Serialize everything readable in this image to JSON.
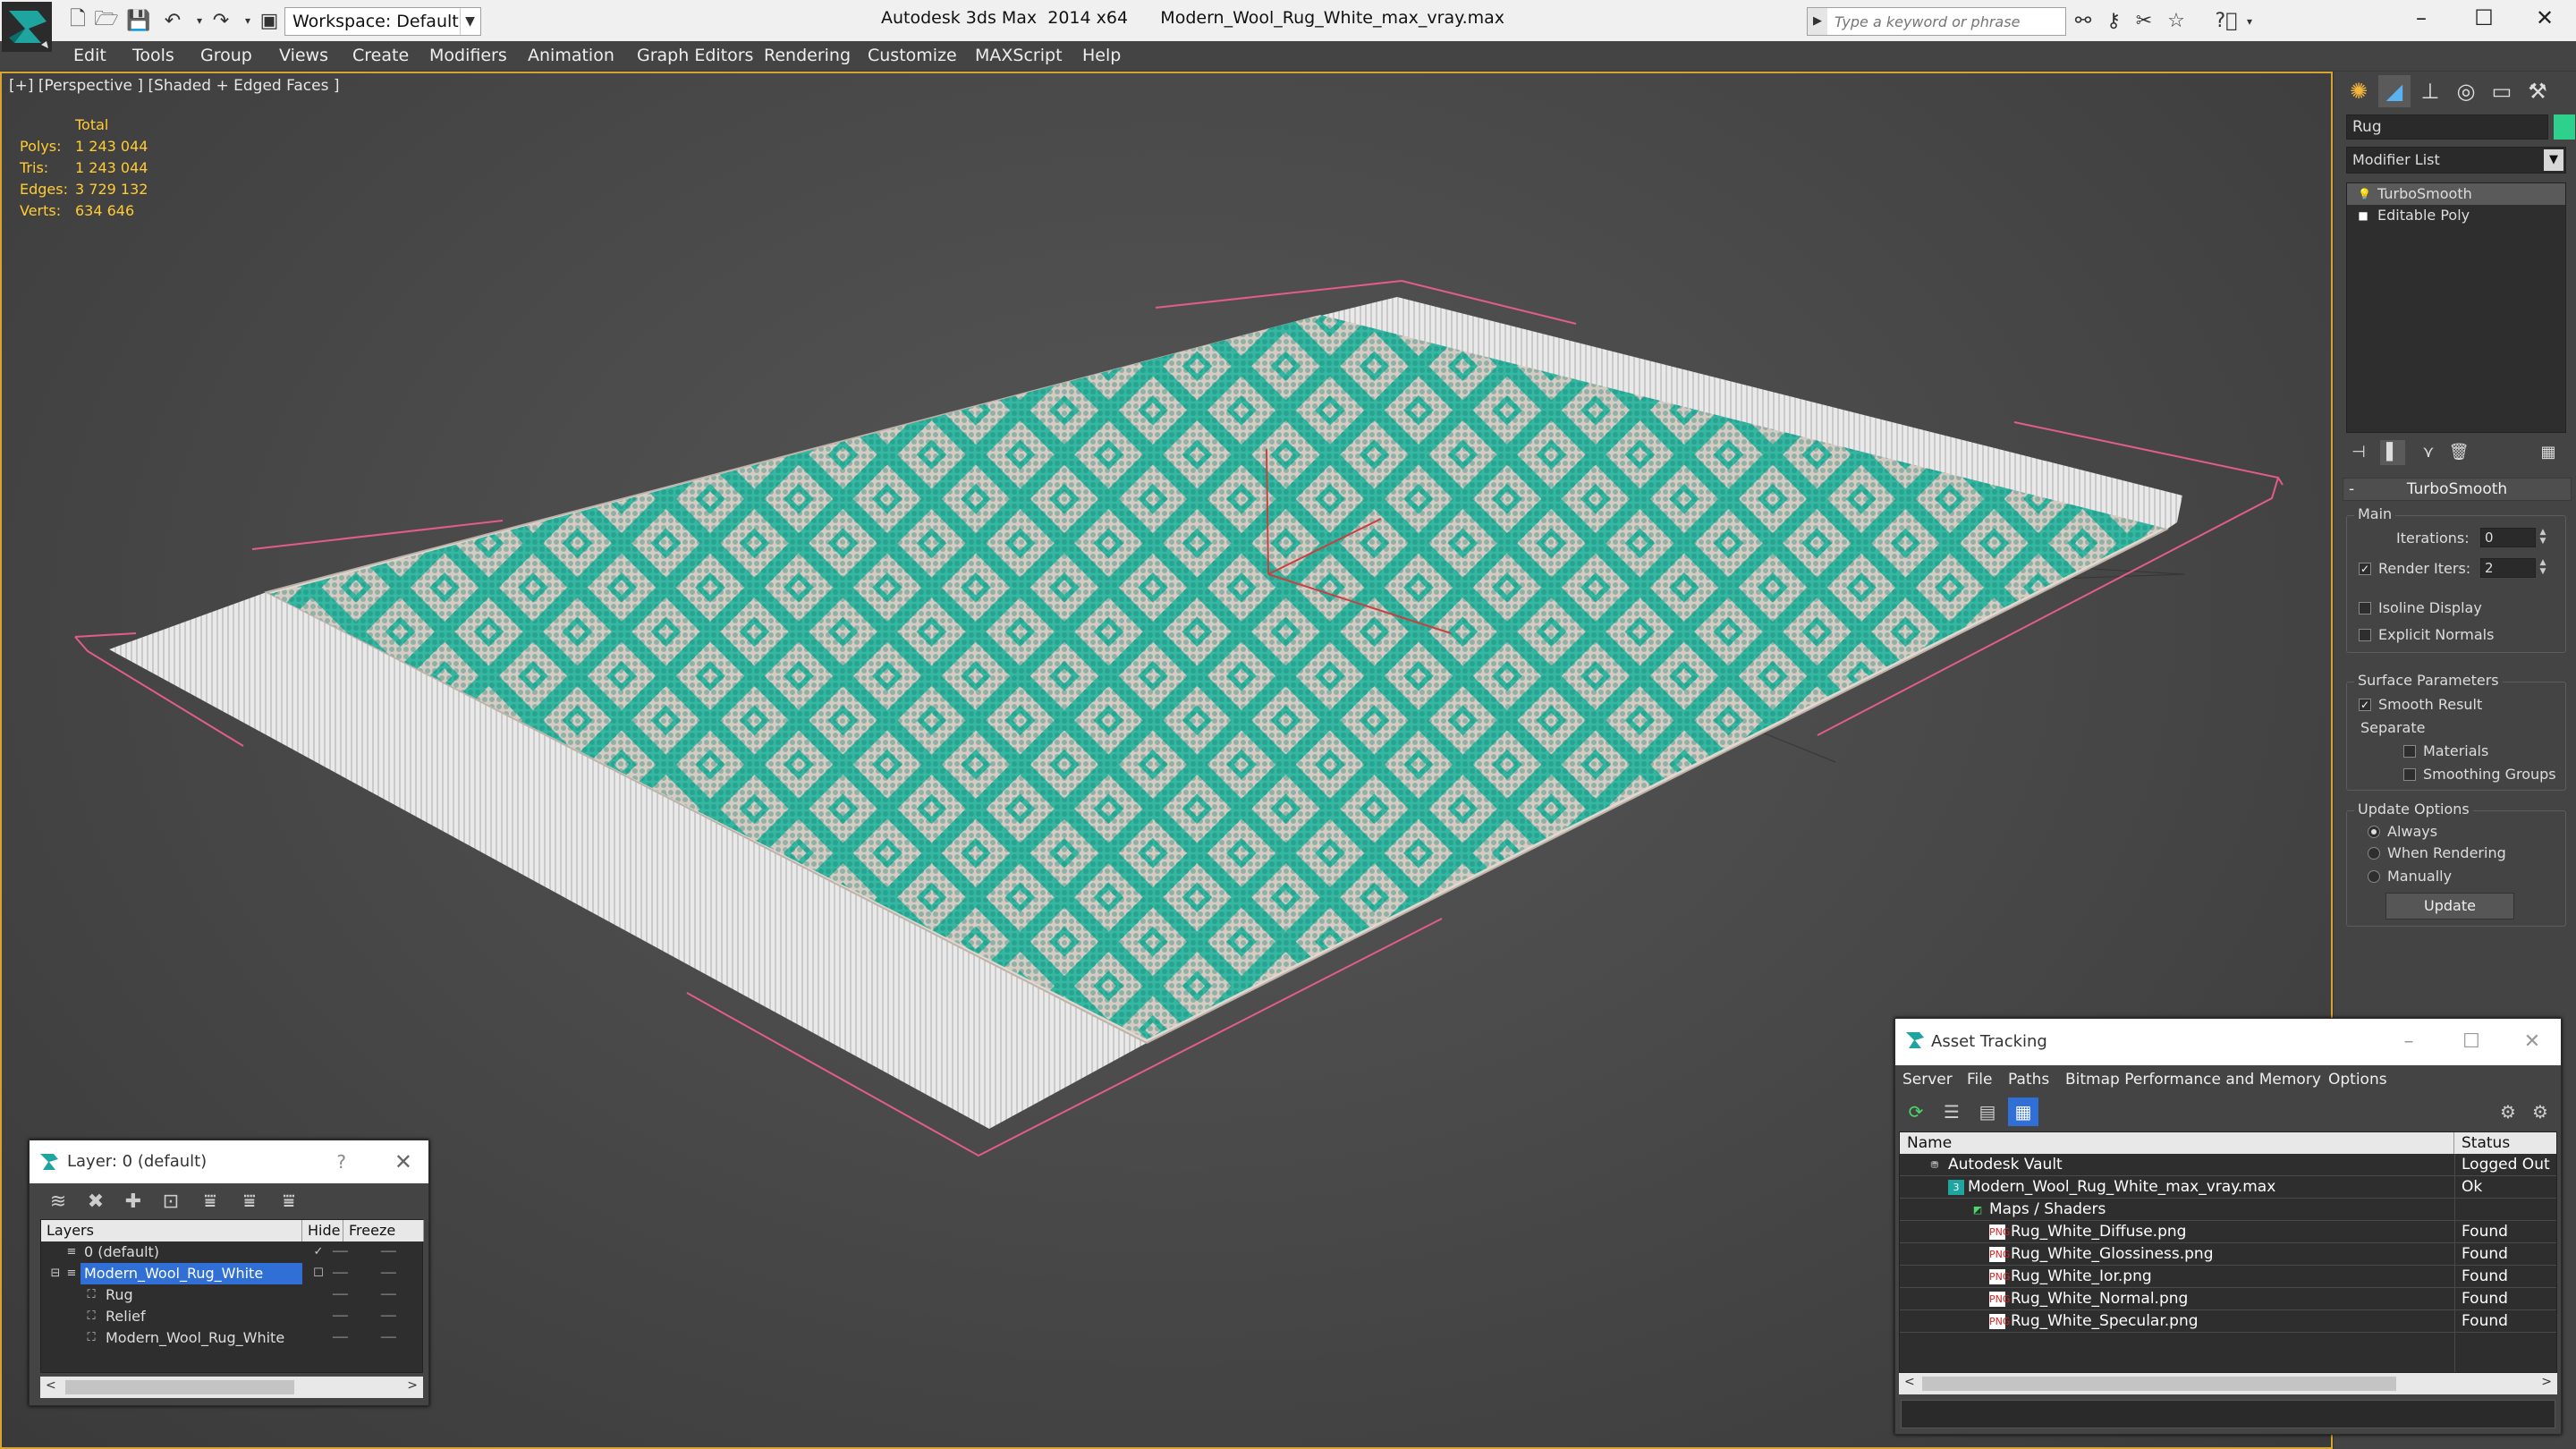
{
  "titlebar": {
    "workspace_label": "Workspace: Default",
    "window_title": "Autodesk 3ds Max  2014 x64      Modern_Wool_Rug_White_max_vray.max",
    "search_placeholder": "Type a keyword or phrase",
    "minimize": "–",
    "maximize": "☐",
    "close": "✕"
  },
  "menu": [
    "Edit",
    "Tools",
    "Group",
    "Views",
    "Create",
    "Modifiers",
    "Animation",
    "Graph Editors",
    "Rendering",
    "Customize",
    "MAXScript",
    "Help"
  ],
  "viewport": {
    "label": "[+] [Perspective ] [Shaded + Edged Faces ]",
    "stats_header": "Total",
    "stats": [
      {
        "label": "Polys:",
        "value": "1 243 044"
      },
      {
        "label": "Tris:",
        "value": "1 243 044"
      },
      {
        "label": "Edges:",
        "value": "3 729 132"
      },
      {
        "label": "Verts:",
        "value": "634 646"
      }
    ]
  },
  "command_panel": {
    "object_name": "Rug",
    "object_color": "#2ed08d",
    "modifier_list": "Modifier List",
    "stack": [
      {
        "label": "TurboSmooth",
        "active": true
      },
      {
        "label": "Editable Poly",
        "active": false
      }
    ],
    "rollout_title": "TurboSmooth",
    "rollout_toggle": "-",
    "main_group": "Main",
    "iterations_label": "Iterations:",
    "iterations_value": "0",
    "render_iters_label": "Render Iters:",
    "render_iters_value": "2",
    "render_iters_checked": true,
    "isoline_label": "Isoline Display",
    "explicit_normals_label": "Explicit Normals",
    "surface_group": "Surface Parameters",
    "smooth_result_label": "Smooth Result",
    "separate_label": "Separate",
    "materials_label": "Materials",
    "smoothing_groups_label": "Smoothing Groups",
    "update_group": "Update Options",
    "always_label": "Always",
    "when_rendering_label": "When Rendering",
    "manually_label": "Manually",
    "update_button": "Update"
  },
  "layer_dialog": {
    "title": "Layer: 0 (default)",
    "help": "?",
    "close": "✕",
    "col_layers": "Layers",
    "col_hide": "Hide",
    "col_freeze": "Freeze",
    "rows": [
      {
        "name": "0 (default)",
        "indent": 0,
        "selected": false,
        "mark": "✓"
      },
      {
        "name": "Modern_Wool_Rug_White",
        "indent": 0,
        "selected": true,
        "mark": "☐"
      },
      {
        "name": "Rug",
        "indent": 1,
        "selected": false,
        "mark": ""
      },
      {
        "name": "Relief",
        "indent": 1,
        "selected": false,
        "mark": ""
      },
      {
        "name": "Modern_Wool_Rug_White",
        "indent": 1,
        "selected": false,
        "mark": ""
      }
    ]
  },
  "asset_tracking": {
    "title": "Asset Tracking",
    "menu": [
      "Server",
      "File",
      "Paths",
      "Bitmap Performance and Memory",
      "Options"
    ],
    "col_name": "Name",
    "col_status": "Status",
    "rows": [
      {
        "name": "Autodesk Vault",
        "status": "Logged Out",
        "indent": 0,
        "icon": "vault"
      },
      {
        "name": "Modern_Wool_Rug_White_max_vray.max",
        "status": "Ok",
        "indent": 1,
        "icon": "max"
      },
      {
        "name": "Maps / Shaders",
        "status": "",
        "indent": 2,
        "icon": "maps"
      },
      {
        "name": "Rug_White_Diffuse.png",
        "status": "Found",
        "indent": 3,
        "icon": "png"
      },
      {
        "name": "Rug_White_Glossiness.png",
        "status": "Found",
        "indent": 3,
        "icon": "png"
      },
      {
        "name": "Rug_White_Ior.png",
        "status": "Found",
        "indent": 3,
        "icon": "png"
      },
      {
        "name": "Rug_White_Normal.png",
        "status": "Found",
        "indent": 3,
        "icon": "png"
      },
      {
        "name": "Rug_White_Specular.png",
        "status": "Found",
        "indent": 3,
        "icon": "png"
      }
    ]
  },
  "colors": {
    "viewport_border": "#d6a431",
    "stats_text": "#ffcc33",
    "rug_pattern": "#2cb5a0",
    "selection_blue": "#2f6fd6"
  }
}
